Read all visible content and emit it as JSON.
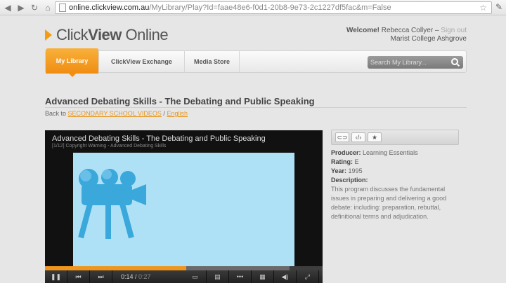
{
  "browser": {
    "url_host": "online.clickview.com.au",
    "url_path": "/MyLibrary/Play?Id=faae48e6-f0d1-20b8-9e73-2c1227df5fac&m=False"
  },
  "header": {
    "logo_click": "Click",
    "logo_view": "View",
    "logo_online": " Online",
    "welcome_label": "Welcome!",
    "user_name": "Rebecca Collyer",
    "signout": "Sign out",
    "school": "Marist College Ashgrove"
  },
  "nav": {
    "tabs": [
      {
        "label": "My Library"
      },
      {
        "label": "ClickView Exchange"
      },
      {
        "label": "Media Store"
      }
    ],
    "search_placeholder": "Search My Library..."
  },
  "page": {
    "title": "Advanced Debating Skills - The Debating and Public Speaking",
    "breadcrumb_prefix": "Back to",
    "breadcrumb_link1": "SECONDARY SCHOOL VIDEOS",
    "breadcrumb_sep": "/",
    "breadcrumb_link2": "English"
  },
  "player": {
    "title": "Advanced Debating Skills - The Debating and Public Speaking",
    "subtitle": "[1/12] Copyright Warning - Advanced Debating Skills",
    "current_time": "0:14",
    "total_time": "0:27",
    "progress_percent": 51,
    "buffered_percent": 88
  },
  "details": {
    "producer_label": "Producer:",
    "producer": "Learning Essentials",
    "rating_label": "Rating:",
    "rating": "E",
    "year_label": "Year:",
    "year": "1995",
    "description_label": "Description:",
    "description": "This program discusses the fundamental issues in preparing and delivering a good debate: including: preparation, rebuttal, definitional terms and adjudication."
  },
  "colors": {
    "accent": "#f0961c",
    "link": "#e8961e",
    "video_bg": "#aee0f6"
  }
}
